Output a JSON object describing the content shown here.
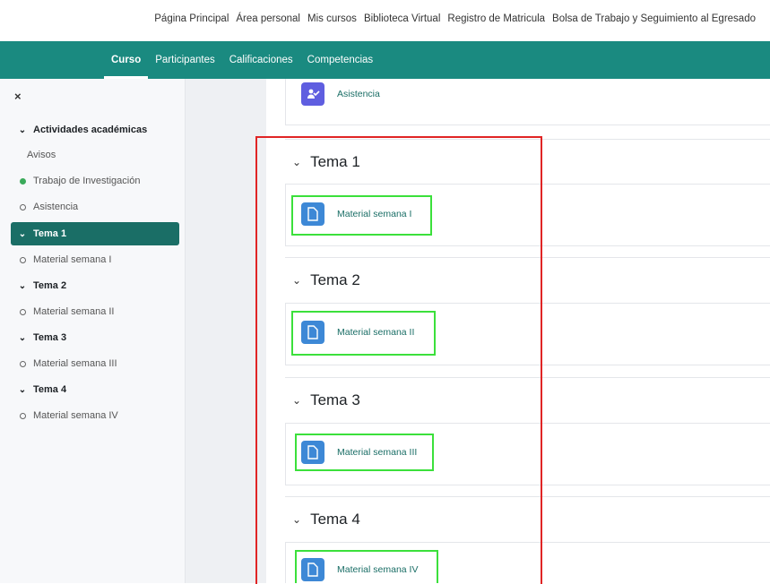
{
  "top_nav": [
    "Página Principal",
    "Área personal",
    "Mis cursos",
    "Biblioteca Virtual",
    "Registro de Matricula",
    "Bolsa de Trabajo y Seguimiento al Egresado"
  ],
  "tabs": [
    "Curso",
    "Participantes",
    "Calificaciones",
    "Competencias"
  ],
  "sidebar": {
    "close_glyph": "×",
    "items": [
      {
        "label": "Actividades académicas",
        "marker": "chevron"
      },
      {
        "label": "Avisos",
        "marker": "none"
      },
      {
        "label": "Trabajo de Investigación",
        "marker": "green-dot"
      },
      {
        "label": "Asistencia",
        "marker": "circle"
      },
      {
        "label": "Tema 1",
        "marker": "chevron",
        "active": true
      },
      {
        "label": "Material semana I",
        "marker": "circle"
      },
      {
        "label": "Tema 2",
        "marker": "chevron"
      },
      {
        "label": "Material semana II",
        "marker": "circle"
      },
      {
        "label": "Tema 3",
        "marker": "chevron"
      },
      {
        "label": "Material semana III",
        "marker": "circle"
      },
      {
        "label": "Tema 4",
        "marker": "chevron"
      },
      {
        "label": "Material semana IV",
        "marker": "circle"
      }
    ]
  },
  "content": {
    "attendance": {
      "label": "Asistencia",
      "icon": "attendance-icon"
    },
    "sections": [
      {
        "title": "Tema 1",
        "activity": "Material semana I",
        "icon": "file-icon"
      },
      {
        "title": "Tema 2",
        "activity": "Material semana II",
        "icon": "file-icon"
      },
      {
        "title": "Tema 3",
        "activity": "Material semana III",
        "icon": "file-icon"
      },
      {
        "title": "Tema 4",
        "activity": "Material semana IV",
        "icon": "file-icon"
      }
    ]
  },
  "colors": {
    "brand": "#1a8a80",
    "active_item": "#1a6e66",
    "annotation_red": "#e02525",
    "annotation_green": "#3be03b"
  }
}
